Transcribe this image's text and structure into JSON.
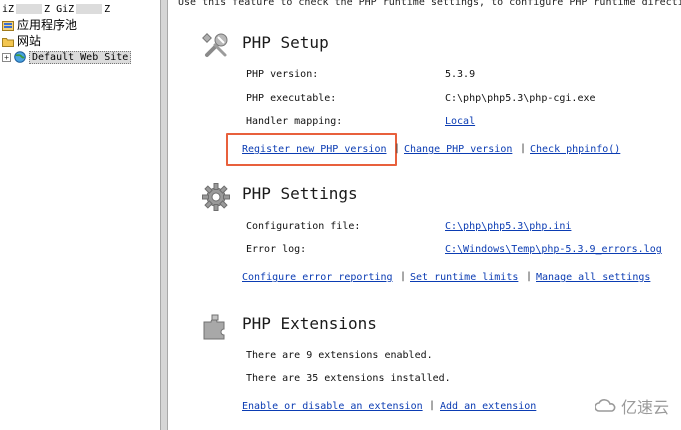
{
  "tree": {
    "header_left": "iZ",
    "header_mid": "Z",
    "header_right": "GiZ",
    "header_end": "Z",
    "items": [
      {
        "label": "应用程序池",
        "icon": "app-pool-icon"
      },
      {
        "label": "网站",
        "icon": "sites-folder-icon"
      },
      {
        "label": "Default Web Site",
        "icon": "globe-icon",
        "expander": "+"
      }
    ]
  },
  "content": {
    "intro": "Use this feature to check the PHP runtime settings, to configure PHP runtime directi",
    "setup": {
      "title": "PHP Setup",
      "icon": "tools-icon",
      "rows": [
        {
          "label": "PHP version:",
          "value": "5.3.9"
        },
        {
          "label": "PHP executable:",
          "value": "C:\\php\\php5.3\\php-cgi.exe"
        },
        {
          "label": "Handler mapping:",
          "value": "Local"
        }
      ],
      "actions": [
        "Register new PHP version",
        "Change PHP version",
        "Check phpinfo()"
      ]
    },
    "settings": {
      "title": "PHP Settings",
      "icon": "gear-icon",
      "rows": [
        {
          "label": "Configuration file:",
          "value": "C:\\php\\php5.3\\php.ini"
        },
        {
          "label": "Error log:",
          "value": "C:\\Windows\\Temp\\php-5.3.9_errors.log"
        }
      ],
      "actions": [
        "Configure error reporting",
        "Set runtime limits",
        "Manage all settings"
      ]
    },
    "extensions": {
      "title": "PHP Extensions",
      "icon": "puzzle-icon",
      "lines": [
        "There are 9 extensions enabled.",
        "There are 35 extensions installed."
      ],
      "actions": [
        "Enable or disable an extension",
        "Add an extension"
      ]
    },
    "separator": "|"
  },
  "watermark": {
    "text": "亿速云",
    "icon": "cloud-logo-icon"
  },
  "colors": {
    "link": "#0b3cb3",
    "highlight": "#e8603c",
    "splitter": "#d6d6d6"
  }
}
